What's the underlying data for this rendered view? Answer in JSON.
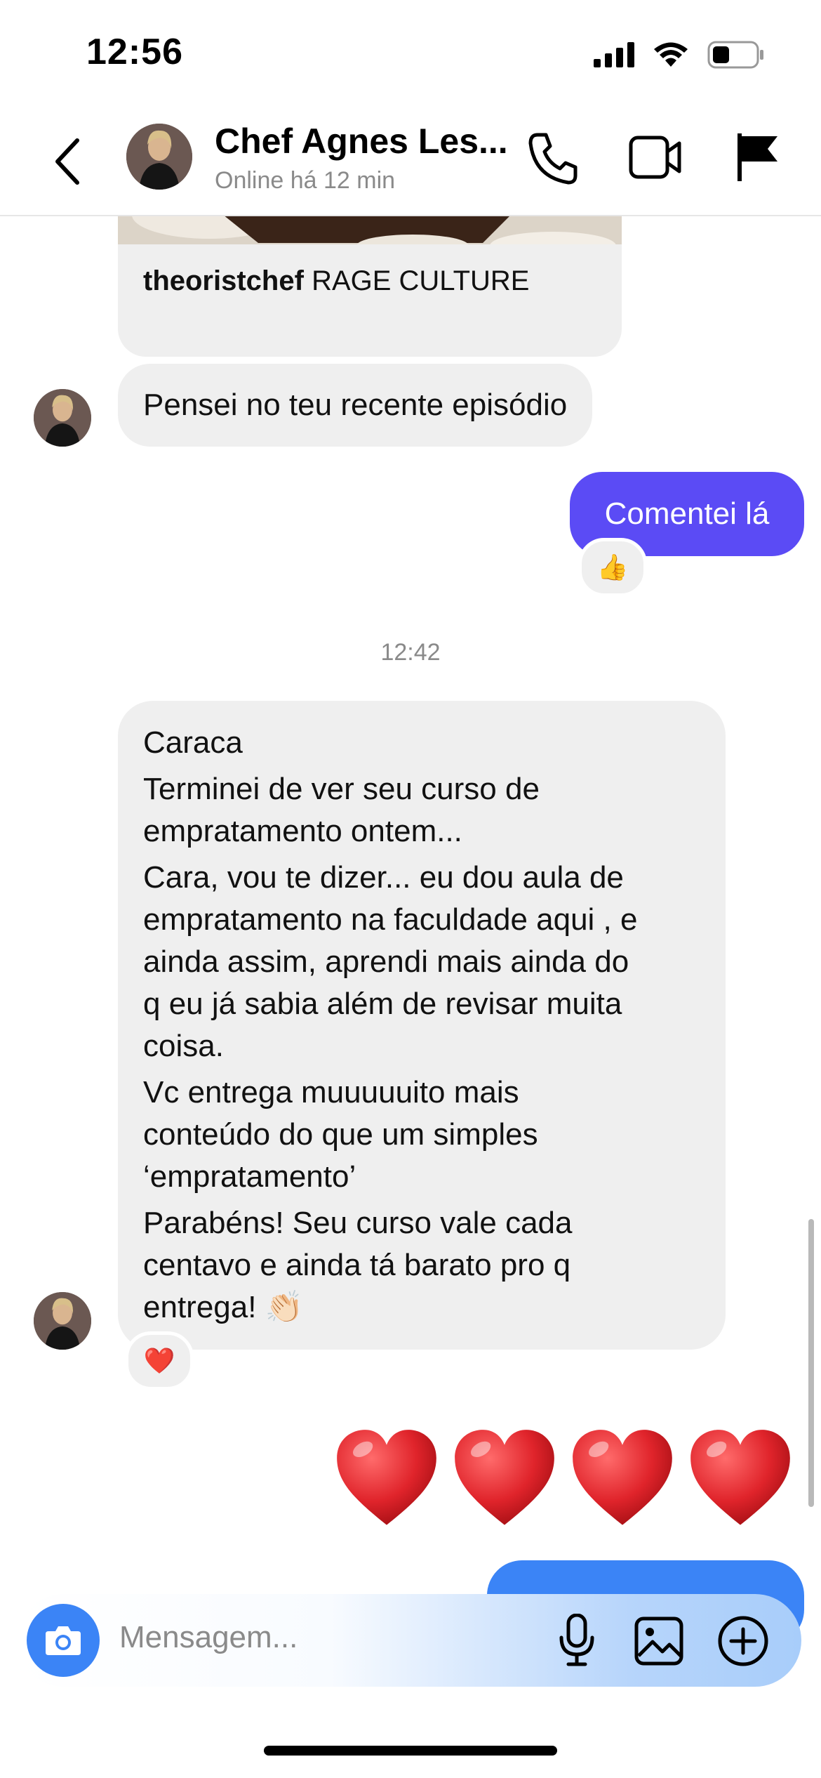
{
  "status_bar": {
    "time": "12:56",
    "battery_level": 0.4
  },
  "header": {
    "name": "Chef Agnes Les...",
    "status": "Online há 12 min",
    "icons": [
      "back-chevron-icon",
      "phone-icon",
      "video-camera-icon",
      "flag-icon"
    ]
  },
  "messages": {
    "shared_post": {
      "username": "theoristchef",
      "caption": "RAGE CULTURE"
    },
    "incoming_1": "Pensei no teu recente episódio",
    "outgoing_1": "Comentei lá",
    "outgoing_1_reaction": "👍",
    "timestamp": "12:42",
    "incoming_long": [
      "Caraca",
      "Terminei de ver seu curso de\nempratamento ontem...",
      "Cara, vou te dizer... eu dou aula de\nempratamento na faculdade aqui , e\nainda assim, aprendi mais ainda do\nq eu já sabia além de revisar muita\ncoisa.",
      "Vc entrega muuuuuito mais\nconteúdo do que um simples\n‘empratamento’",
      "Parabéns! Seu curso vale  cada\ncentavo e ainda tá barato pro q\nentrega! 👏🏻"
    ],
    "incoming_long_reaction": "❤️",
    "outgoing_hearts_count": 4
  },
  "composer": {
    "placeholder": "Mensagem..."
  },
  "colors": {
    "outgoing": "#5b4bf5",
    "incoming": "#efefef",
    "accent_blue": "#3b84f6"
  }
}
